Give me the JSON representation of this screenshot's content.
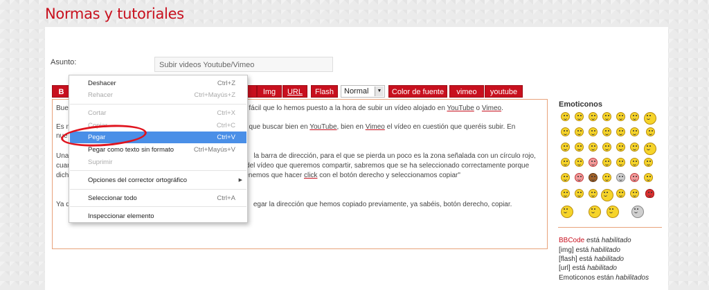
{
  "page_title": "Normas y tutoriales",
  "subject": {
    "label": "Asunto:",
    "value": "Subir videos Youtube/Vimeo"
  },
  "toolbar": {
    "b": "B",
    "img": "Img",
    "url": "URL",
    "flash": "Flash",
    "size_select": "Normal",
    "color": "Color de fuente",
    "vimeo": "vimeo",
    "youtube": "youtube"
  },
  "editor": {
    "line1": {
      "start": "Bue",
      "mid": "lo fácil que lo hemos puesto a la hora de subir un vídeo alojado en ",
      "link1": "YouTube",
      "conj": " o ",
      "link2": "Vimeo",
      "end": "."
    },
    "line2": {
      "start": "Es m",
      "mid": "s que buscar bien en ",
      "link1": "YouTube",
      "mid2": ", bien en ",
      "link2": "Vimeo",
      "end": " el vídeo en cuestión que queréis subir. En"
    },
    "line3": {
      "start": "nue"
    },
    "line4": {
      "start": "Una",
      "mid": "la barra de dirección, para el que se pierda un poco es la zona señalada con un círculo rojo,"
    },
    "line5": {
      "start": "cuan",
      "mid": "\" del vídeo que queremos compartir, sabremos que se ha seleccionado correctamente porque"
    },
    "line6": {
      "start": "dich",
      "mid": "enemos que hacer ",
      "link": "click",
      "end": " con el botón derecho y seleccionamos copiar\""
    },
    "line7": {
      "start": "Ya q",
      "mid": "egar la dirección que hemos copiado previamente, ya sabéis, botón derecho, copiar."
    }
  },
  "context_menu": {
    "items": [
      {
        "label": "Deshacer",
        "shortcut": "Ctrl+Z"
      },
      {
        "label": "Rehacer",
        "shortcut": "Ctrl+Mayús+Z"
      },
      {
        "label": "Cortar",
        "shortcut": "Ctrl+X"
      },
      {
        "label": "Copiar",
        "shortcut": "Ctrl+C"
      },
      {
        "label": "Pegar",
        "shortcut": "Ctrl+V"
      },
      {
        "label": "Pegar como texto sin formato",
        "shortcut": "Ctrl+Mayús+V"
      },
      {
        "label": "Suprimir",
        "shortcut": ""
      },
      {
        "label": "Opciones del corrector ortográfico",
        "shortcut": ""
      },
      {
        "label": "Seleccionar todo",
        "shortcut": "Ctrl+A"
      },
      {
        "label": "Inspeccionar elemento",
        "shortcut": ""
      }
    ],
    "submenu_arrow": "▶"
  },
  "emoticons": {
    "title": "Emoticonos"
  },
  "bbcode_status": {
    "bbcode": {
      "name": "BBCode",
      "verb": " está ",
      "state": "habilitado"
    },
    "img": {
      "name": "[img]",
      "verb": " está ",
      "state": "habilitado"
    },
    "flash": {
      "name": "[flash]",
      "verb": " está ",
      "state": "habilitado"
    },
    "url": {
      "name": "[url]",
      "verb": " está ",
      "state": "habilitado"
    },
    "emoticons": {
      "name": "Emoticonos",
      "verb": " están ",
      "state": "habilitados"
    }
  },
  "colors": {
    "accent": "#c8101e",
    "menu_highlight": "#4a8fe7",
    "editor_border": "#e8a27a",
    "annotation": "#e0141e"
  }
}
